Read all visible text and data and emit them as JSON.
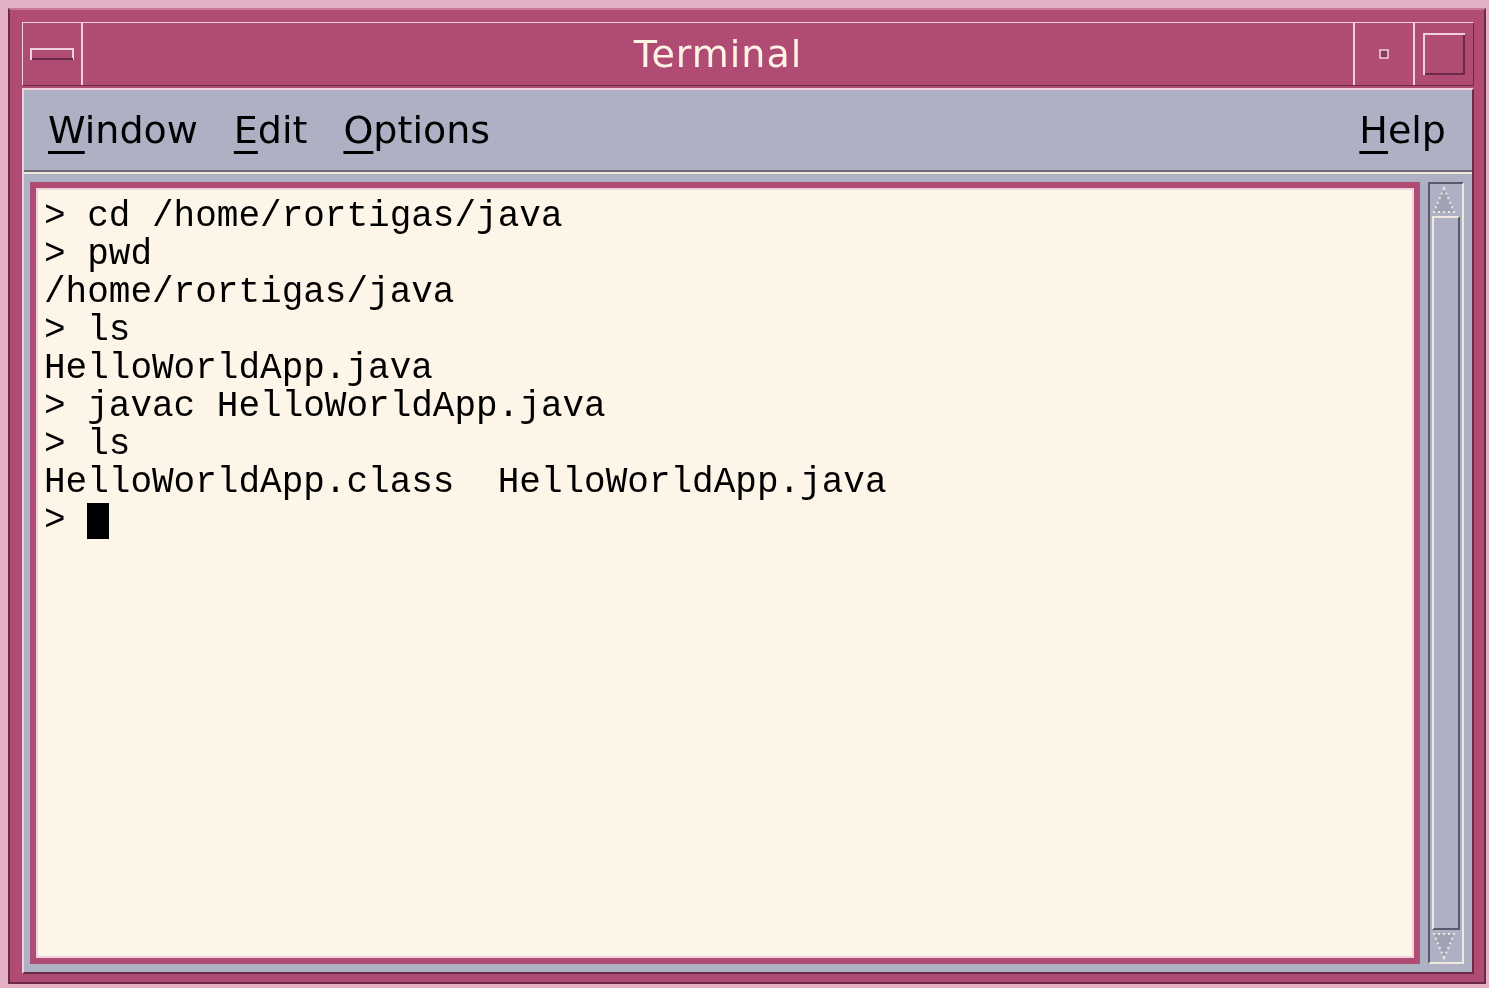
{
  "window": {
    "title": "Terminal"
  },
  "menus": [
    {
      "label": "Window"
    },
    {
      "label": "Edit"
    },
    {
      "label": "Options"
    }
  ],
  "help_menu": {
    "label": "Help"
  },
  "terminal": {
    "lines": [
      "> cd /home/rortigas/java",
      "> pwd",
      "/home/rortigas/java",
      "> ls",
      "HelloWorldApp.java",
      "> javac HelloWorldApp.java",
      "> ls",
      "HelloWorldApp.class  HelloWorldApp.java",
      "> "
    ],
    "cursor": true
  }
}
